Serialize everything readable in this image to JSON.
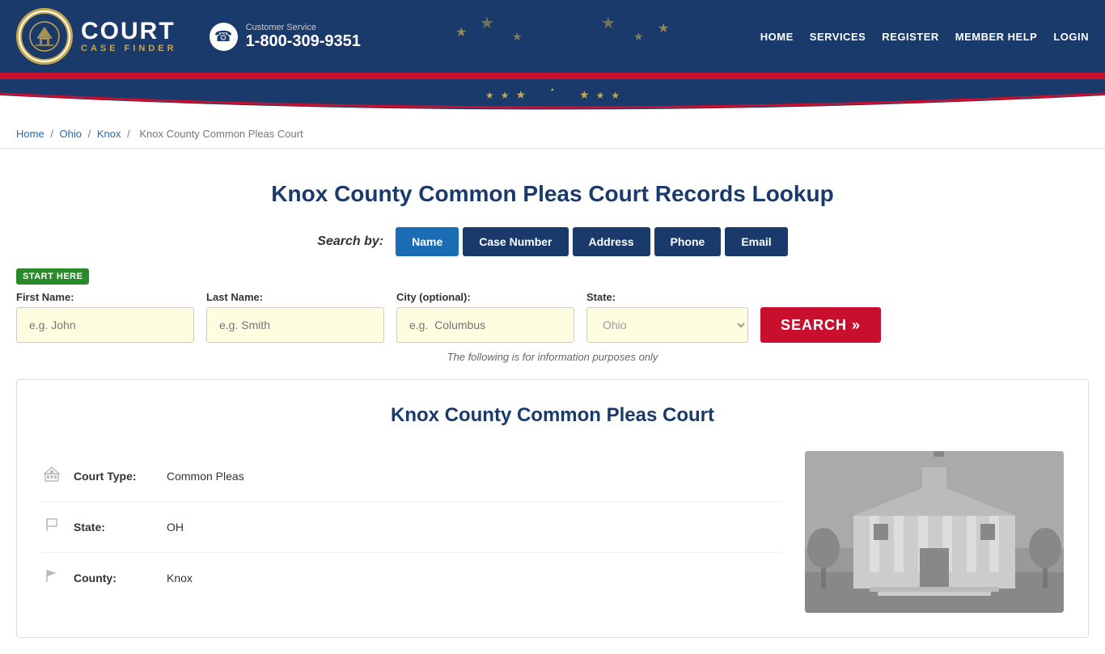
{
  "header": {
    "logo_court": "COURT",
    "logo_sub": "CASE FINDER",
    "phone_label": "Customer Service",
    "phone_number": "1-800-309-9351",
    "nav_items": [
      {
        "label": "HOME",
        "href": "#"
      },
      {
        "label": "SERVICES",
        "href": "#"
      },
      {
        "label": "REGISTER",
        "href": "#"
      },
      {
        "label": "MEMBER HELP",
        "href": "#"
      },
      {
        "label": "LOGIN",
        "href": "#"
      }
    ]
  },
  "breadcrumb": {
    "items": [
      {
        "label": "Home",
        "href": "#"
      },
      {
        "label": "Ohio",
        "href": "#"
      },
      {
        "label": "Knox",
        "href": "#"
      },
      {
        "label": "Knox County Common Pleas Court",
        "href": null
      }
    ]
  },
  "page": {
    "title": "Knox County Common Pleas Court Records Lookup"
  },
  "search": {
    "by_label": "Search by:",
    "tabs": [
      {
        "label": "Name",
        "active": true
      },
      {
        "label": "Case Number",
        "active": false
      },
      {
        "label": "Address",
        "active": false
      },
      {
        "label": "Phone",
        "active": false
      },
      {
        "label": "Email",
        "active": false
      }
    ],
    "start_here": "START HERE",
    "fields": {
      "first_name_label": "First Name:",
      "first_name_placeholder": "e.g. John",
      "last_name_label": "Last Name:",
      "last_name_placeholder": "e.g. Smith",
      "city_label": "City (optional):",
      "city_placeholder": "e.g.  Columbus",
      "state_label": "State:",
      "state_value": "Ohio"
    },
    "search_btn": "SEARCH »",
    "info_note": "The following is for information purposes only"
  },
  "court_card": {
    "title": "Knox County Common Pleas Court",
    "fields": [
      {
        "icon": "building",
        "label": "Court Type:",
        "value": "Common Pleas"
      },
      {
        "icon": "flag-outline",
        "label": "State:",
        "value": "OH"
      },
      {
        "icon": "flag",
        "label": "County:",
        "value": "Knox"
      }
    ]
  }
}
